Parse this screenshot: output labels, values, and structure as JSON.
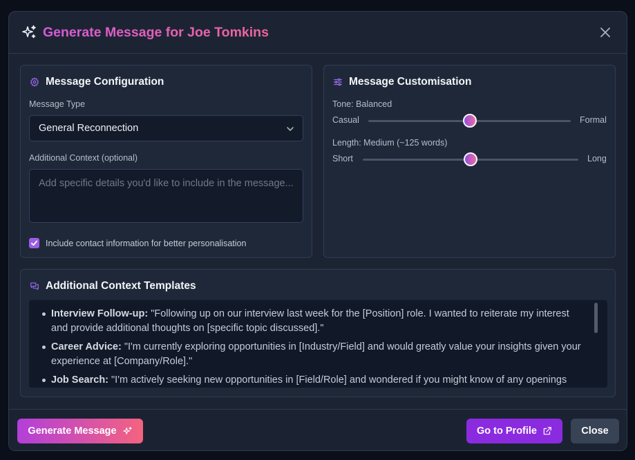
{
  "modal": {
    "title": "Generate Message for Joe Tomkins",
    "accent_gradient": [
      "#d65bd8",
      "#f0669a"
    ]
  },
  "configuration": {
    "title": "Message Configuration",
    "message_type_label": "Message Type",
    "message_type_value": "General Reconnection",
    "context_label": "Additional Context (optional)",
    "context_placeholder": "Add specific details you'd like to include in the message...",
    "include_contact_checked": true,
    "include_contact_label": "Include contact information for better personalisation"
  },
  "customisation": {
    "title": "Message Customisation",
    "tone": {
      "label": "Tone: Balanced",
      "min_label": "Casual",
      "max_label": "Formal",
      "value_fraction": 0.5
    },
    "length": {
      "label": "Length: Medium (~125 words)",
      "min_label": "Short",
      "max_label": "Long",
      "value_fraction": 0.5
    }
  },
  "templates": {
    "title": "Additional Context Templates",
    "items": [
      {
        "name": "Interview Follow-up:",
        "text": "\"Following up on our interview last week for the [Position] role. I wanted to reiterate my interest and provide additional thoughts on [specific topic discussed].\""
      },
      {
        "name": "Career Advice:",
        "text": "\"I'm currently exploring opportunities in [Industry/Field] and would greatly value your insights given your experience at [Company/Role].\""
      },
      {
        "name": "Job Search:",
        "text": "\"I'm actively seeking new opportunities in [Field/Role] and wondered if you might know of any openings"
      }
    ]
  },
  "footer": {
    "generate_label": "Generate Message",
    "profile_label": "Go to Profile",
    "close_label": "Close"
  },
  "colors": {
    "purple": "#8b2be0",
    "checkbox": "#9b5de5",
    "icon_purple": "#9b6cf0"
  }
}
